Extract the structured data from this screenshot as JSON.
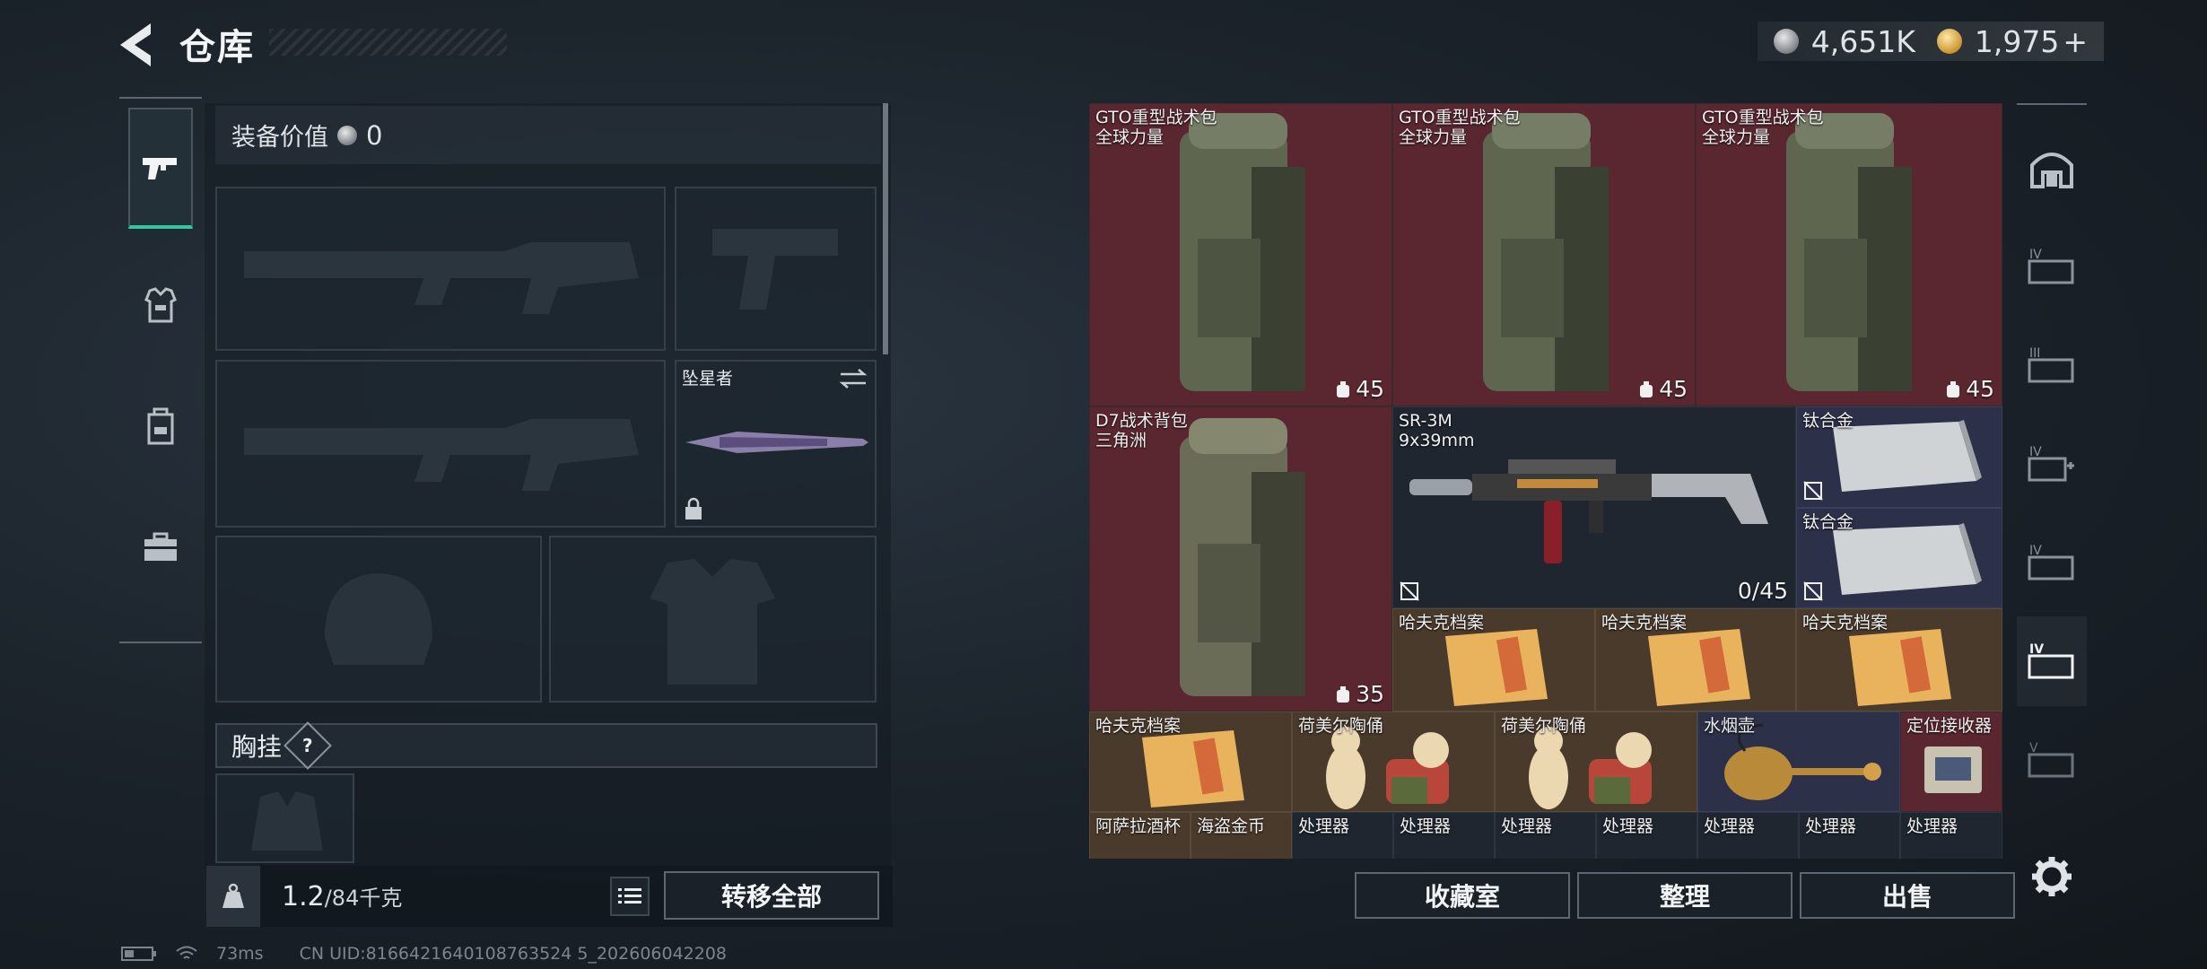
{
  "header": {
    "title": "仓库",
    "silver_amount": "4,651K",
    "gold_amount": "1,975",
    "gold_plus": "+"
  },
  "equipment": {
    "value_label": "装备价值",
    "value_amount": "0",
    "melee_name": "坠星者",
    "chest_label": "胸挂",
    "chest_help": "?"
  },
  "bottom_left": {
    "weight_current": "1.2",
    "weight_max": "/84千克",
    "transfer_all": "转移全部"
  },
  "status": {
    "ping": "73ms",
    "uid": "CN UID:8166421640108763524 5_202606042208"
  },
  "grid_items": [
    {
      "name": "GTO重型战术包",
      "sub": "全球力量",
      "count": "45"
    },
    {
      "name": "GTO重型战术包",
      "sub": "全球力量",
      "count": "45"
    },
    {
      "name": "GTO重型战术包",
      "sub": "全球力量",
      "count": "45"
    },
    {
      "name": "D7战术背包",
      "sub": "三角洲",
      "count": "35"
    },
    {
      "name": "SR-3M",
      "sub": "9x39mm",
      "count": "0/45"
    },
    {
      "name": "钛合金",
      "sub": ""
    },
    {
      "name": "钛合金",
      "sub": ""
    },
    {
      "name": "哈夫克档案",
      "sub": ""
    },
    {
      "name": "哈夫克档案",
      "sub": ""
    },
    {
      "name": "哈夫克档案",
      "sub": ""
    },
    {
      "name": "哈夫克档案",
      "sub": ""
    },
    {
      "name": "荷美尔陶俑",
      "sub": ""
    },
    {
      "name": "荷美尔陶俑",
      "sub": ""
    },
    {
      "name": "水烟壶",
      "sub": ""
    },
    {
      "name": "定位接收器",
      "sub": ""
    },
    {
      "name": "阿萨拉酒杯",
      "sub": ""
    },
    {
      "name": "海盗金币",
      "sub": ""
    },
    {
      "name": "处理器",
      "sub": ""
    },
    {
      "name": "处理器",
      "sub": ""
    },
    {
      "name": "处理器",
      "sub": ""
    },
    {
      "name": "处理器",
      "sub": ""
    },
    {
      "name": "处理器",
      "sub": ""
    },
    {
      "name": "处理器",
      "sub": ""
    },
    {
      "name": "处理器",
      "sub": ""
    }
  ],
  "bottom_right": {
    "collection": "收藏室",
    "organize": "整理",
    "sell": "出售"
  },
  "right_tabs": [
    "IV",
    "III",
    "IV",
    "IV",
    "IV",
    "V"
  ],
  "colors": {
    "accent": "#2fc7a0",
    "red_cell": "#5a2730",
    "gold_cell": "#4a3a2c",
    "blue_cell": "#2c3048"
  }
}
